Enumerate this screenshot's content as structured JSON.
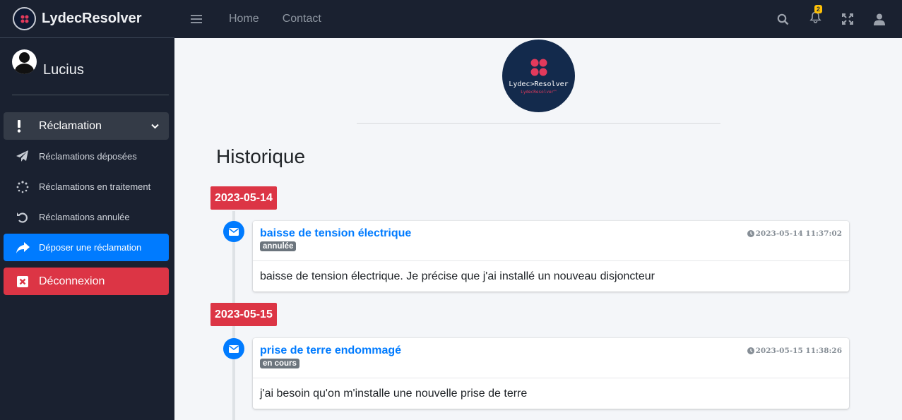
{
  "app": {
    "brand": "LydecResolver"
  },
  "user": {
    "name": "Lucius"
  },
  "sidebar": {
    "main": {
      "label": "Réclamation"
    },
    "items": [
      {
        "label": "Réclamations déposées",
        "icon": "paper-plane-icon"
      },
      {
        "label": "Réclamations en traitement",
        "icon": "spinner-icon"
      },
      {
        "label": "Réclamations annulée",
        "icon": "undo-icon"
      },
      {
        "label": "Déposer une réclamation",
        "icon": "share-icon"
      }
    ],
    "logout": {
      "label": "Déconnexion",
      "icon": "close-square-icon"
    }
  },
  "topbar": {
    "links": [
      "Home",
      "Contact"
    ],
    "notifications_count": "2"
  },
  "logo": {
    "title": "Lydec>Resolver",
    "subtitle": "LydecResolver™"
  },
  "page": {
    "title": "Historique"
  },
  "timeline": [
    {
      "date": "2023-05-14",
      "title": "baisse de tension électrique",
      "status": "annulée",
      "time": "2023-05-14 11:37:02",
      "body": "baisse de tension électrique. Je précise que j'ai installé un nouveau disjoncteur"
    },
    {
      "date": "2023-05-15",
      "title": "prise de terre endommagé",
      "status": "en cours",
      "time": "2023-05-15 11:38:26",
      "body": "j'ai besoin qu'on m'installe une nouvelle prise de terre"
    }
  ],
  "colors": {
    "sidebar": "#1a2130",
    "primary": "#007bff",
    "danger": "#dc3545",
    "badge": "#6c757d",
    "warning": "#ffc107"
  }
}
